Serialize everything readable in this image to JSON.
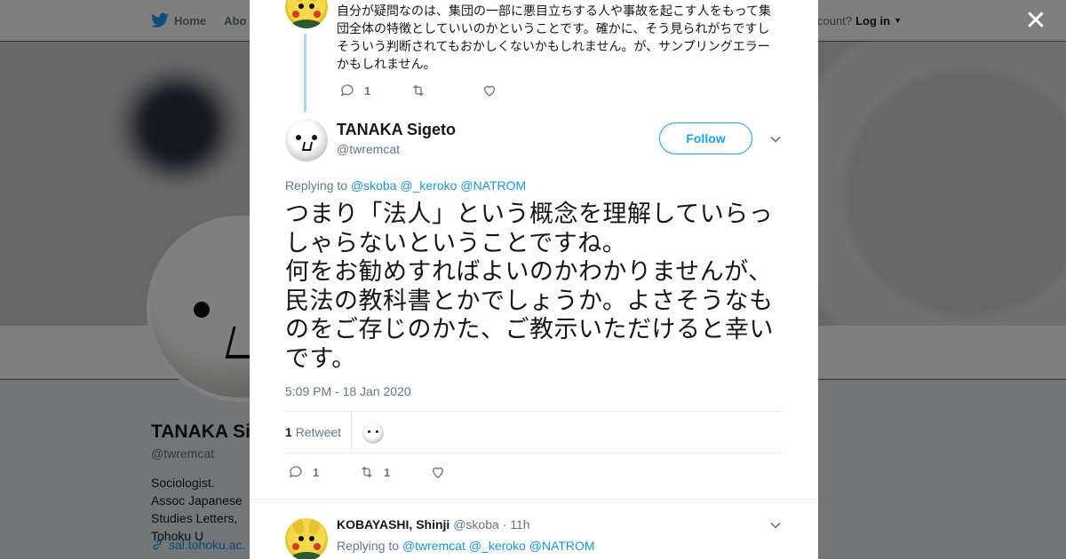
{
  "background": {
    "nav": {
      "home_label": "Home",
      "about_label": "Abo"
    },
    "login": {
      "prompt": "ccount?",
      "login_label": "Log in"
    },
    "profile": {
      "name": "TANAKA Si",
      "handle": "@twremcat",
      "bio": "Sociologist. Assoc Japanese Studies Letters, Tohoku U",
      "link": "sal.tohoku.ac."
    }
  },
  "modal": {
    "prev_tweet": {
      "text": "自分が疑問なのは、集団の一部に悪目立ちする人や事故を起こす人をもって集団全体の特徴としていいのかということです。確かに、そう見られがちですしそういう判断されてもおかしくないかもしれません。が、サンプリングエラーかもしれません。",
      "reply_count": "1",
      "retweet_count": "",
      "like_count": ""
    },
    "main_tweet": {
      "author_name": "TANAKA Sigeto",
      "author_handle": "@twremcat",
      "follow_label": "Follow",
      "replying_prefix": "Replying to",
      "mentions": [
        "@skoba",
        "@_keroko",
        "@NATROM"
      ],
      "text": "つまり「法人」という概念を理解していらっしゃらないということですね。\n何をお勧めすればよいのかわかりませんが、民法の教科書とかでしょうか。よさそうなものをご存じのかた、ご教示いただけると幸いです。",
      "timestamp": "5:09 PM - 18 Jan 2020",
      "retweet_stat_count": "1",
      "retweet_stat_label": "Retweet",
      "reply_count": "1",
      "retweet_count": "1",
      "like_count": ""
    },
    "reply_tweet": {
      "author_name": "KOBAYASHI, Shinji",
      "author_handle": "@skoba",
      "time": "11h",
      "replying_prefix": "Replying to",
      "mentions": [
        "@twremcat",
        "@_keroko",
        "@NATROM"
      ]
    }
  },
  "icons": {
    "twitter_bird": "twitter-bird-icon",
    "close": "close-icon",
    "reply": "reply-icon",
    "retweet": "retweet-icon",
    "like": "heart-icon",
    "chevron": "chevron-down-icon",
    "link": "link-icon"
  },
  "colors": {
    "accent": "#1da1f2",
    "mention": "#1b95e0",
    "thread_line": "#a9d6f5",
    "muted": "#657786"
  }
}
